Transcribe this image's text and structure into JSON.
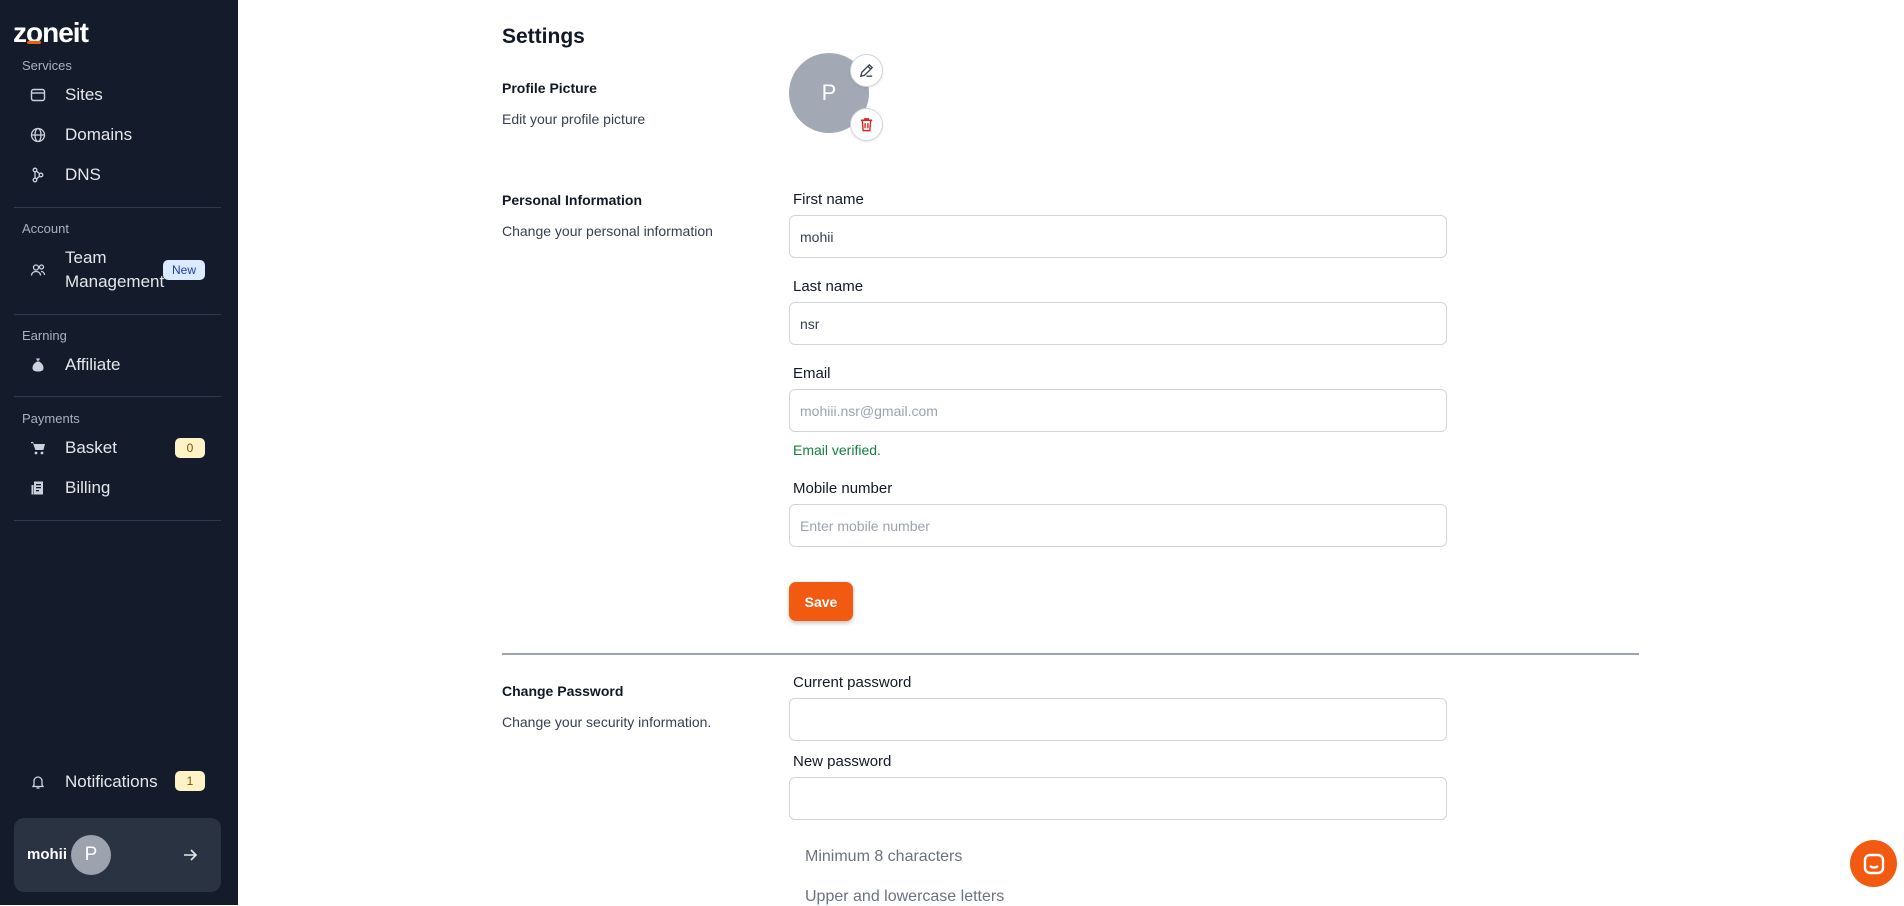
{
  "sidebar": {
    "logo": "zoneit",
    "sections": {
      "services": "Services",
      "account": "Account",
      "earning": "Earning",
      "payments": "Payments"
    },
    "items": {
      "sites": "Sites",
      "domains": "Domains",
      "dns": "DNS",
      "team_line1": "Team",
      "team_line2": "Management",
      "team_badge": "New",
      "affiliate": "Affiliate",
      "basket": "Basket",
      "basket_count": "0",
      "billing": "Billing",
      "notifications": "Notifications",
      "notifications_count": "1"
    },
    "user": {
      "name": "mohii",
      "initial": "P"
    }
  },
  "main": {
    "title": "Settings",
    "profile_picture": {
      "title": "Profile Picture",
      "desc": "Edit your profile picture",
      "initial": "P"
    },
    "personal": {
      "title": "Personal Information",
      "desc": "Change your personal information",
      "first_name_label": "First name",
      "first_name_value": "mohii",
      "last_name_label": "Last name",
      "last_name_value": "nsr",
      "email_label": "Email",
      "email_value": "mohiii.nsr@gmail.com",
      "email_status": "Email verified.",
      "mobile_label": "Mobile number",
      "mobile_placeholder": "Enter mobile number",
      "save_label": "Save"
    },
    "password": {
      "title": "Change Password",
      "desc": "Change your security information.",
      "current_label": "Current password",
      "new_label": "New password",
      "requirements": [
        "Minimum 8 characters",
        "Upper and lowercase letters"
      ]
    }
  },
  "colors": {
    "accent": "#f25a12",
    "sidebar_bg": "#141b2b",
    "verified": "#15803d"
  }
}
